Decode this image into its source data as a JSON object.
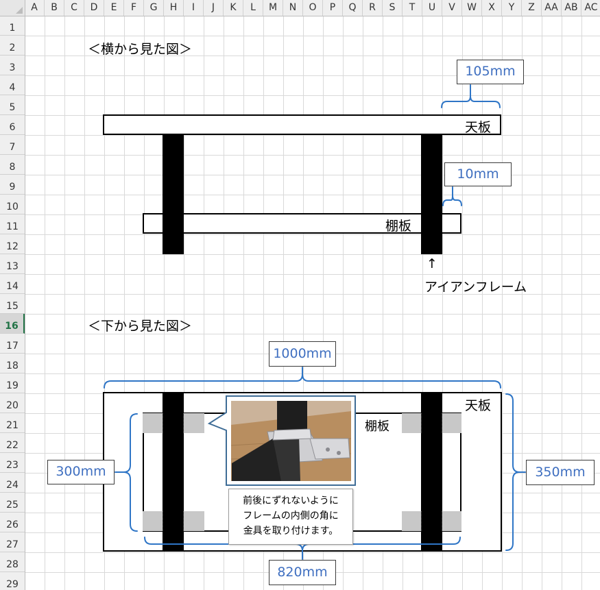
{
  "columns": [
    "A",
    "B",
    "C",
    "D",
    "E",
    "F",
    "G",
    "H",
    "I",
    "J",
    "K",
    "L",
    "M",
    "N",
    "O",
    "P",
    "Q",
    "R",
    "S",
    "T",
    "U",
    "V",
    "W",
    "X",
    "Y",
    "Z",
    "AA",
    "AB",
    "AC"
  ],
  "rows": [
    "1",
    "2",
    "3",
    "4",
    "5",
    "6",
    "7",
    "8",
    "9",
    "10",
    "11",
    "12",
    "13",
    "14",
    "15",
    "16",
    "17",
    "18",
    "19",
    "20",
    "21",
    "22",
    "23",
    "24",
    "25",
    "26",
    "27",
    "28",
    "29"
  ],
  "active_row": "16",
  "side_view": {
    "heading": "＜横から見た図＞",
    "top_board_label": "天板",
    "shelf_label": "棚板",
    "arrow": "↑",
    "frame_label": "アイアンフレーム",
    "dim_overhang": "105mm",
    "dim_offset": "10mm"
  },
  "bottom_view": {
    "heading": "＜下から見た図＞",
    "top_board_label": "天板",
    "shelf_label": "棚板",
    "dim_width": "1000mm",
    "dim_depth": "350mm",
    "dim_shelf_depth": "300mm",
    "dim_shelf_width": "820mm",
    "note_lines": [
      "前後にずれないように",
      "フレームの内側の角に",
      "金具を取り付けます。"
    ]
  },
  "colors": {
    "dimension_text": "#3f6fc0",
    "bracket": "#2e75c6",
    "active_header": "#217346"
  }
}
